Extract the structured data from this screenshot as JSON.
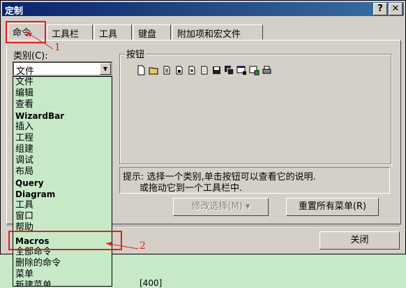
{
  "window": {
    "title": "定制",
    "help_button": "?",
    "close_button": "✕"
  },
  "tabs": [
    {
      "label": "命令"
    },
    {
      "label": "工具栏"
    },
    {
      "label": "工具"
    },
    {
      "label": "键盘"
    },
    {
      "label": "附加项和宏文件"
    }
  ],
  "category": {
    "label": "类别(C):",
    "selected": "文件",
    "options": [
      "文件",
      "编辑",
      "查看",
      "WizardBar",
      "插入",
      "工程",
      "组建",
      "调试",
      "布局",
      "Query",
      "Diagram",
      "工具",
      "窗口",
      "帮助",
      "Macros",
      "全部命令",
      "删除的命令",
      "菜单",
      "新建菜单"
    ]
  },
  "buttons_group": {
    "title": "按钮",
    "icons": [
      "new-file-icon",
      "open-folder-icon",
      "copy-page-icon",
      "save-page-icon",
      "print-page-icon",
      "page-icon",
      "save-disk-icon",
      "save-all-icon",
      "toolbar-window-icon",
      "settings-window-icon",
      "printer-icon"
    ]
  },
  "hint": {
    "line1": "提示: 选择一个类别,单击按钮可以查看它的说明.",
    "line2": "或拖动它到一个工具栏中."
  },
  "actions": {
    "modify": "修改选择(M) ▾",
    "reset": "重置所有菜单(R)",
    "close": "关闭"
  },
  "annotations": {
    "n1": "1",
    "n2": "2"
  },
  "bottom_text": "[400]",
  "colors": {
    "annotation": "#e02020",
    "list_bg": "#c7e9c8",
    "title_bar": "#0a246a"
  }
}
